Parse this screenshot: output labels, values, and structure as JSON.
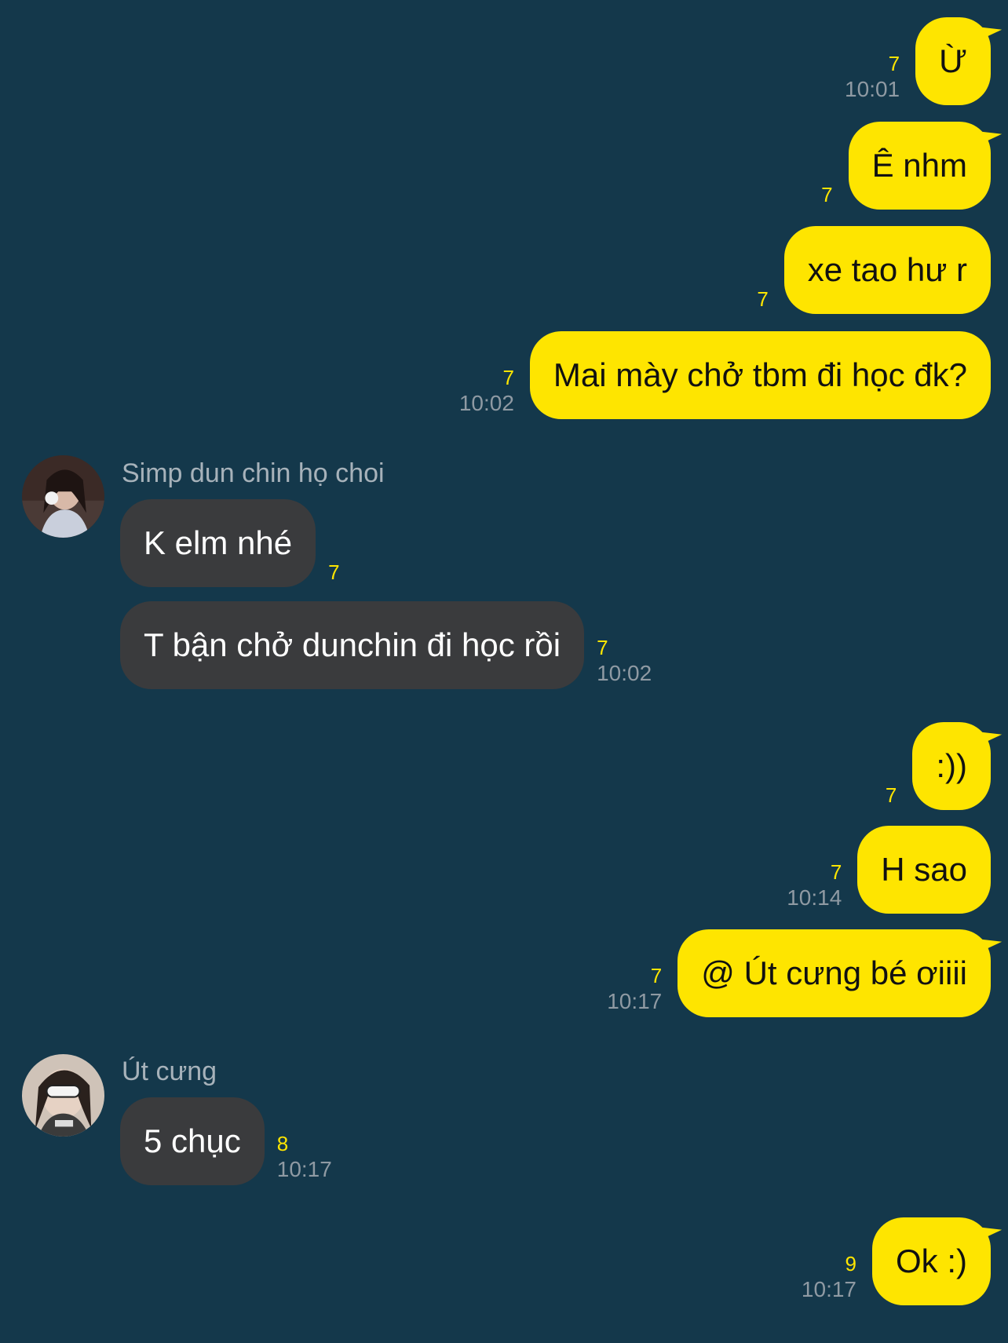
{
  "colors": {
    "background": "#14384b",
    "my_bubble": "#fee500",
    "their_bubble": "#3a3b3d",
    "unread_count": "#fee500",
    "timestamp": "#8f9aa3"
  },
  "messages": [
    {
      "from": "me",
      "text": "Ừ",
      "count": "7",
      "time": "10:01"
    },
    {
      "from": "me",
      "text": "Ê nhm",
      "count": "7",
      "time": ""
    },
    {
      "from": "me",
      "text": "xe tao hư r",
      "count": "7",
      "time": ""
    },
    {
      "from": "me",
      "text": "Mai mày chở tbm đi học đk?",
      "count": "7",
      "time": "10:02"
    },
    {
      "from": "them",
      "sender": "Simp dun chin họ choi",
      "text": "K elm nhé",
      "count": "7",
      "time": ""
    },
    {
      "from": "them",
      "text": "T bận chở dunchin đi học rồi",
      "count": "7",
      "time": "10:02"
    },
    {
      "from": "me",
      "text": ":))",
      "count": "7",
      "time": ""
    },
    {
      "from": "me",
      "text": "H sao",
      "count": "7",
      "time": "10:14"
    },
    {
      "from": "me",
      "text": "@ Út cưng bé ơiiii",
      "count": "7",
      "time": "10:17"
    },
    {
      "from": "them",
      "sender": "Út cưng",
      "text": "5 chục",
      "count": "8",
      "time": "10:17"
    },
    {
      "from": "me",
      "text": "Ok :)",
      "count": "9",
      "time": "10:17"
    }
  ],
  "avatars": [
    {
      "icon": "profile-photo-icon"
    },
    {
      "icon": "profile-photo-icon"
    }
  ]
}
